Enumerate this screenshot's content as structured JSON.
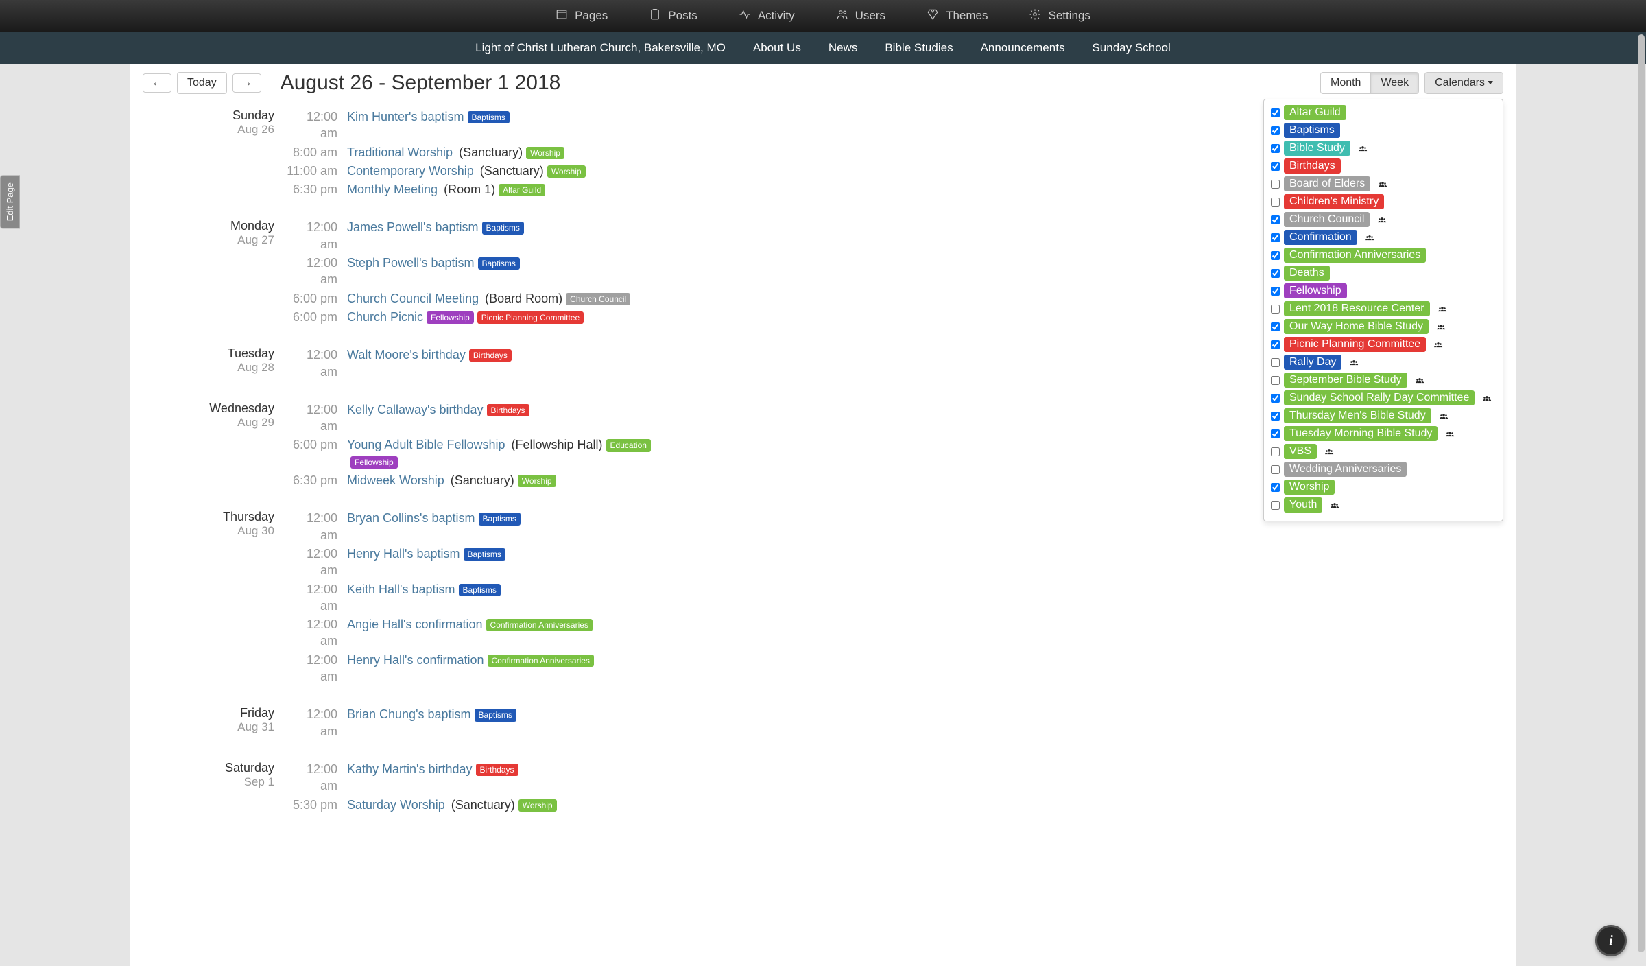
{
  "admin_nav": {
    "pages": "Pages",
    "posts": "Posts",
    "activity": "Activity",
    "users": "Users",
    "themes": "Themes",
    "settings": "Settings"
  },
  "site_nav": {
    "site_title": "Light of Christ Lutheran Church, Bakersville, MO",
    "about": "About Us",
    "news": "News",
    "bible_studies": "Bible Studies",
    "announcements": "Announcements",
    "sunday_school": "Sunday School"
  },
  "edit_page_label": "Edit Page",
  "toolbar": {
    "prev": "←",
    "next": "→",
    "today": "Today",
    "title": "August 26 - September 1 2018",
    "month": "Month",
    "week": "Week",
    "calendars": "Calendars"
  },
  "filters": [
    {
      "label": "Altar Guild",
      "checked": true,
      "color": "c-green",
      "group": false
    },
    {
      "label": "Baptisms",
      "checked": true,
      "color": "c-blue",
      "group": false
    },
    {
      "label": "Bible Study",
      "checked": true,
      "color": "c-teal",
      "group": true
    },
    {
      "label": "Birthdays",
      "checked": true,
      "color": "c-red",
      "group": false
    },
    {
      "label": "Board of Elders",
      "checked": false,
      "color": "c-grey",
      "group": true
    },
    {
      "label": "Children's Ministry",
      "checked": false,
      "color": "c-red",
      "group": false
    },
    {
      "label": "Church Council",
      "checked": true,
      "color": "c-grey",
      "group": true
    },
    {
      "label": "Confirmation",
      "checked": true,
      "color": "c-blue",
      "group": true
    },
    {
      "label": "Confirmation Anniversaries",
      "checked": true,
      "color": "c-green",
      "group": false
    },
    {
      "label": "Deaths",
      "checked": true,
      "color": "c-green",
      "group": false
    },
    {
      "label": "Fellowship",
      "checked": true,
      "color": "c-purple",
      "group": false
    },
    {
      "label": "Lent 2018 Resource Center",
      "checked": false,
      "color": "c-green",
      "group": true
    },
    {
      "label": "Our Way Home Bible Study",
      "checked": true,
      "color": "c-green",
      "group": true
    },
    {
      "label": "Picnic Planning Committee",
      "checked": true,
      "color": "c-red",
      "group": true
    },
    {
      "label": "Rally Day",
      "checked": false,
      "color": "c-blue",
      "group": true
    },
    {
      "label": "September Bible Study",
      "checked": false,
      "color": "c-green",
      "group": true
    },
    {
      "label": "Sunday School Rally Day Committee",
      "checked": true,
      "color": "c-green",
      "group": true
    },
    {
      "label": "Thursday Men's Bible Study",
      "checked": true,
      "color": "c-green",
      "group": true
    },
    {
      "label": "Tuesday Morning Bible Study",
      "checked": true,
      "color": "c-green",
      "group": true
    },
    {
      "label": "VBS",
      "checked": false,
      "color": "c-green",
      "group": true
    },
    {
      "label": "Wedding Anniversaries",
      "checked": false,
      "color": "c-grey",
      "group": false
    },
    {
      "label": "Worship",
      "checked": true,
      "color": "c-green",
      "group": false
    },
    {
      "label": "Youth",
      "checked": false,
      "color": "c-green",
      "group": true
    }
  ],
  "days": [
    {
      "name": "Sunday",
      "date": "Aug 26",
      "events": [
        {
          "time": "12:00 am",
          "title": "Kim Hunter's baptism",
          "location": "",
          "tags": [
            {
              "label": "Baptisms",
              "color": "c-blue"
            }
          ]
        },
        {
          "time": "8:00 am",
          "title": "Traditional Worship",
          "location": "(Sanctuary)",
          "tags": [
            {
              "label": "Worship",
              "color": "c-green"
            }
          ]
        },
        {
          "time": "11:00 am",
          "title": "Contemporary Worship",
          "location": "(Sanctuary)",
          "tags": [
            {
              "label": "Worship",
              "color": "c-green"
            }
          ]
        },
        {
          "time": "6:30 pm",
          "title": "Monthly Meeting",
          "location": "(Room 1)",
          "tags": [
            {
              "label": "Altar Guild",
              "color": "c-green"
            }
          ]
        }
      ]
    },
    {
      "name": "Monday",
      "date": "Aug 27",
      "events": [
        {
          "time": "12:00 am",
          "title": "James Powell's baptism",
          "location": "",
          "tags": [
            {
              "label": "Baptisms",
              "color": "c-blue"
            }
          ]
        },
        {
          "time": "12:00 am",
          "title": "Steph Powell's baptism",
          "location": "",
          "tags": [
            {
              "label": "Baptisms",
              "color": "c-blue"
            }
          ]
        },
        {
          "time": "6:00 pm",
          "title": "Church Council Meeting",
          "location": "(Board Room)",
          "tags": [
            {
              "label": "Church Council",
              "color": "c-grey"
            }
          ]
        },
        {
          "time": "6:00 pm",
          "title": "Church Picnic",
          "location": "",
          "tags": [
            {
              "label": "Fellowship",
              "color": "c-purple"
            },
            {
              "label": "Picnic Planning Committee",
              "color": "c-red"
            }
          ]
        }
      ]
    },
    {
      "name": "Tuesday",
      "date": "Aug 28",
      "events": [
        {
          "time": "12:00 am",
          "title": "Walt Moore's birthday",
          "location": "",
          "tags": [
            {
              "label": "Birthdays",
              "color": "c-red"
            }
          ]
        }
      ]
    },
    {
      "name": "Wednesday",
      "date": "Aug 29",
      "events": [
        {
          "time": "12:00 am",
          "title": "Kelly Callaway's birthday",
          "location": "",
          "tags": [
            {
              "label": "Birthdays",
              "color": "c-red"
            }
          ]
        },
        {
          "time": "6:00 pm",
          "title": "Young Adult Bible Fellowship",
          "location": "(Fellowship Hall)",
          "tags": [
            {
              "label": "Education",
              "color": "c-green"
            },
            {
              "label": "Fellowship",
              "color": "c-purple"
            }
          ]
        },
        {
          "time": "6:30 pm",
          "title": "Midweek Worship",
          "location": "(Sanctuary)",
          "tags": [
            {
              "label": "Worship",
              "color": "c-green"
            }
          ]
        }
      ]
    },
    {
      "name": "Thursday",
      "date": "Aug 30",
      "events": [
        {
          "time": "12:00 am",
          "title": "Bryan Collins's baptism",
          "location": "",
          "tags": [
            {
              "label": "Baptisms",
              "color": "c-blue"
            }
          ]
        },
        {
          "time": "12:00 am",
          "title": "Henry Hall's baptism",
          "location": "",
          "tags": [
            {
              "label": "Baptisms",
              "color": "c-blue"
            }
          ]
        },
        {
          "time": "12:00 am",
          "title": "Keith Hall's baptism",
          "location": "",
          "tags": [
            {
              "label": "Baptisms",
              "color": "c-blue"
            }
          ]
        },
        {
          "time": "12:00 am",
          "title": "Angie Hall's confirmation",
          "location": "",
          "tags": [
            {
              "label": "Confirmation Anniversaries",
              "color": "c-green"
            }
          ]
        },
        {
          "time": "12:00 am",
          "title": "Henry Hall's confirmation",
          "location": "",
          "tags": [
            {
              "label": "Confirmation Anniversaries",
              "color": "c-green"
            }
          ]
        }
      ]
    },
    {
      "name": "Friday",
      "date": "Aug 31",
      "events": [
        {
          "time": "12:00 am",
          "title": "Brian Chung's baptism",
          "location": "",
          "tags": [
            {
              "label": "Baptisms",
              "color": "c-blue"
            }
          ]
        }
      ]
    },
    {
      "name": "Saturday",
      "date": "Sep 1",
      "events": [
        {
          "time": "12:00 am",
          "title": "Kathy Martin's birthday",
          "location": "",
          "tags": [
            {
              "label": "Birthdays",
              "color": "c-red"
            }
          ]
        },
        {
          "time": "5:30 pm",
          "title": "Saturday Worship",
          "location": "(Sanctuary)",
          "tags": [
            {
              "label": "Worship",
              "color": "c-green"
            }
          ]
        }
      ]
    }
  ],
  "info_fab": "i"
}
